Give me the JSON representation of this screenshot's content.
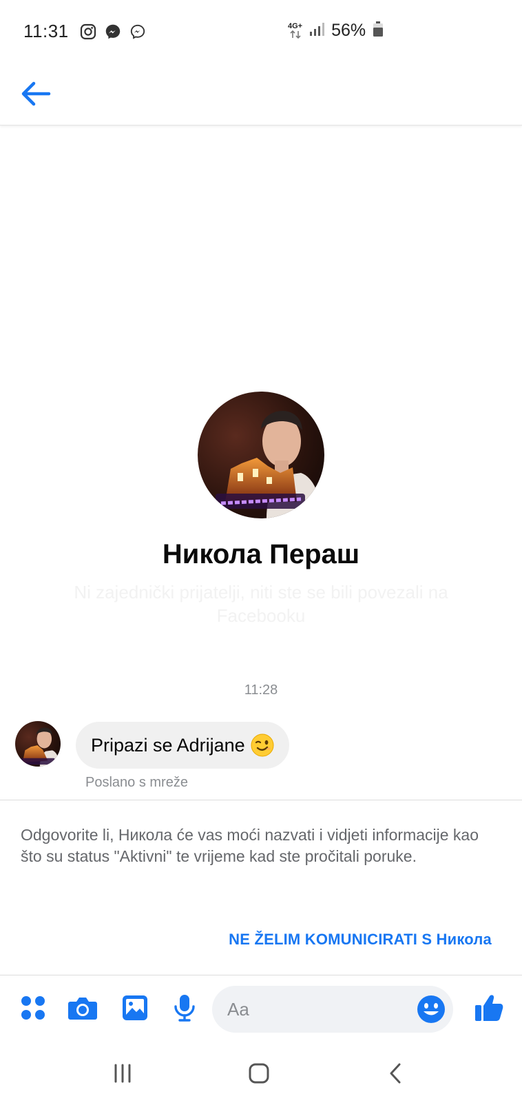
{
  "status_bar": {
    "time": "11:31",
    "network": "4G+",
    "battery": "56%",
    "icons": [
      "instagram-icon",
      "messenger-icon",
      "messenger-icon",
      "signal-icon",
      "battery-icon"
    ]
  },
  "header": {
    "back_icon": "arrow-left-icon"
  },
  "profile": {
    "name": "Никола Пераш",
    "subtitle": "Ni zajednički prijatelji, niti ste se bili povezali na Facebooku"
  },
  "conversation": {
    "timestamp": "11:28",
    "message": {
      "text": "Pripazi se Adrijane",
      "emoji": "winking-face",
      "status": "Poslano s mreže"
    }
  },
  "request": {
    "info": "Odgovorite li, Никола će vas moći nazvati i vidjeti informacije kao što su status \"Aktivni\" te vrijeme kad ste pročitali poruke.",
    "ignore_label": "NE ŽELIM KOMUNICIRATI S Никола"
  },
  "composer": {
    "placeholder": "Aa",
    "icons": [
      "apps-icon",
      "camera-icon",
      "gallery-icon",
      "microphone-icon",
      "emoji-icon",
      "thumbs-up-icon"
    ]
  },
  "navbar": {
    "icons": [
      "recent-apps-icon",
      "home-icon",
      "back-icon"
    ]
  },
  "colors": {
    "accent": "#1877f2",
    "bubble": "#f0f0f0",
    "secondary_text": "#65676b"
  }
}
